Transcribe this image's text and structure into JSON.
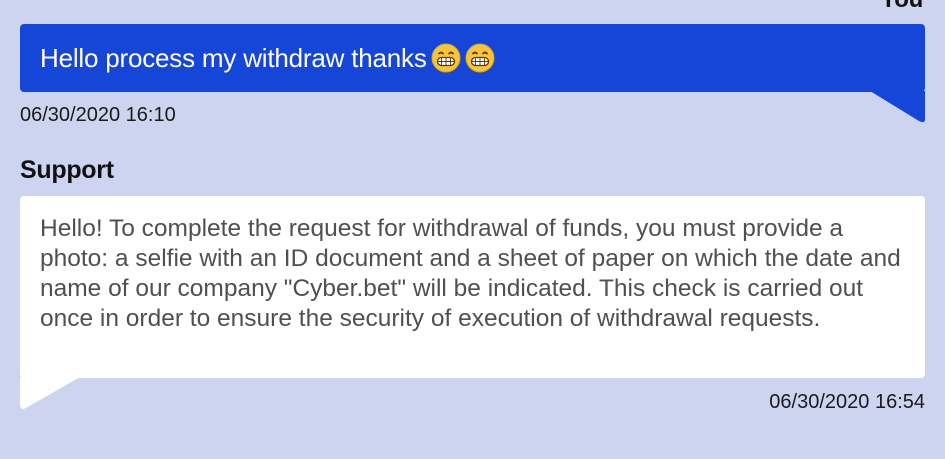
{
  "chat": {
    "sender_user": "You",
    "user_message": {
      "text": "Hello process my withdraw thanks",
      "emoji_icons": [
        "grinning-face-icon",
        "grinning-face-icon"
      ],
      "time": "06/30/2020 16:10",
      "color": "#1546d8"
    },
    "sender_support": "Support",
    "support_message": {
      "text": "Hello! To complete the request for withdrawal of funds, you must provide a photo: a selfie with an ID document and a sheet of paper on which the date and name of our company \"Cyber.bet\" will be indicated. This check is carried out once in order to ensure the security of execution of withdrawal requests.",
      "time": "06/30/2020 16:54",
      "color": "#ffffff"
    },
    "background_color": "#cdd4f0"
  }
}
